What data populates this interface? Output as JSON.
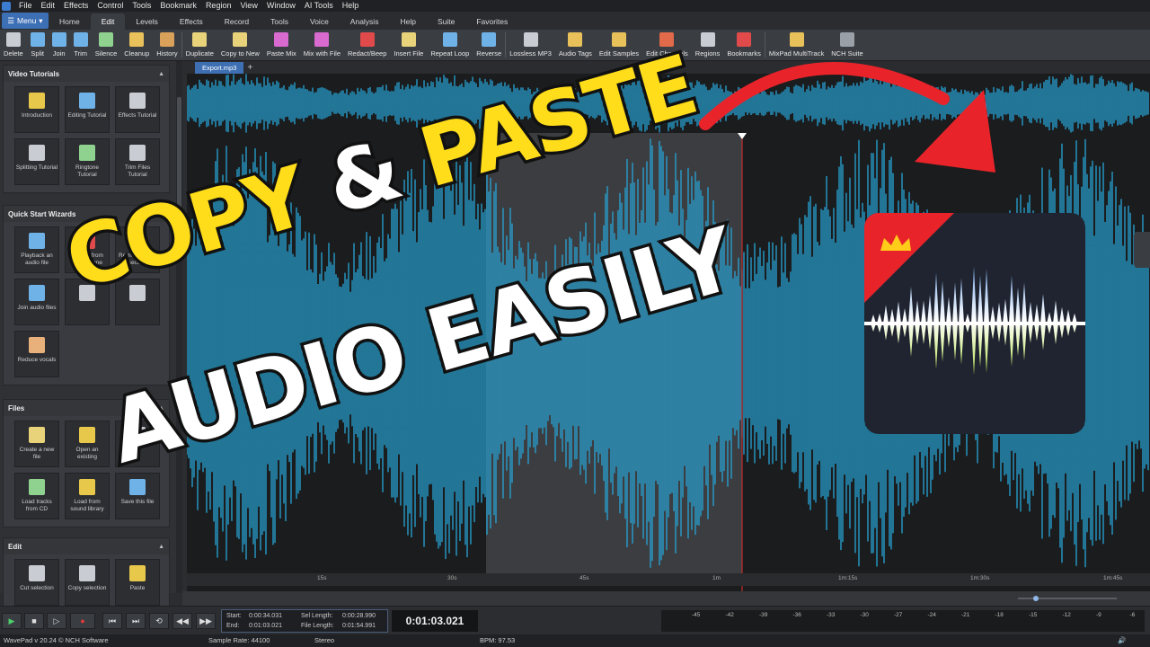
{
  "menubar": [
    "File",
    "Edit",
    "Effects",
    "Control",
    "Tools",
    "Bookmark",
    "Region",
    "View",
    "Window",
    "AI Tools",
    "Help"
  ],
  "ribbon": {
    "menu_label": "Menu",
    "tabs": [
      "Home",
      "Edit",
      "Levels",
      "Effects",
      "Record",
      "Tools",
      "Voice",
      "Analysis",
      "Help",
      "Suite",
      "Favorites"
    ],
    "active_tab": "Edit"
  },
  "toolbar": [
    {
      "label": "Delete",
      "icon": "trash-icon",
      "color": "#c9ccd2"
    },
    {
      "label": "Split",
      "icon": "split-icon",
      "color": "#6fb2e8"
    },
    {
      "label": "Join",
      "icon": "join-icon",
      "color": "#6fb2e8"
    },
    {
      "label": "Trim",
      "icon": "trim-icon",
      "color": "#6fb2e8"
    },
    {
      "label": "Silence",
      "icon": "silence-icon",
      "color": "#8fd18f"
    },
    {
      "label": "Cleanup",
      "icon": "broom-icon",
      "color": "#e8c15a"
    },
    {
      "label": "History",
      "icon": "history-icon",
      "color": "#d9a15a"
    },
    {
      "label": "Duplicate",
      "icon": "duplicate-icon",
      "color": "#e8d27a"
    },
    {
      "label": "Copy to New",
      "icon": "copy-new-icon",
      "color": "#e8d27a"
    },
    {
      "label": "Paste Mix",
      "icon": "paste-mix-icon",
      "color": "#d86ad0"
    },
    {
      "label": "Mix with File",
      "icon": "mix-file-icon",
      "color": "#d86ad0"
    },
    {
      "label": "Redact/Beep",
      "icon": "beep-icon",
      "color": "#e04a4a"
    },
    {
      "label": "Insert File",
      "icon": "insert-file-icon",
      "color": "#e8d27a"
    },
    {
      "label": "Repeat Loop",
      "icon": "loop-icon",
      "color": "#6fb2e8"
    },
    {
      "label": "Reverse",
      "icon": "reverse-icon",
      "color": "#6fb2e8"
    },
    {
      "label": "Lossless MP3",
      "icon": "mp3-icon",
      "color": "#c9ccd2"
    },
    {
      "label": "Audio Tags",
      "icon": "tag-icon",
      "color": "#e8c15a"
    },
    {
      "label": "Edit Samples",
      "icon": "pencil-icon",
      "color": "#e8c15a"
    },
    {
      "label": "Edit Channels",
      "icon": "channels-icon",
      "color": "#e06a4a"
    },
    {
      "label": "Regions",
      "icon": "regions-icon",
      "color": "#c9ccd2"
    },
    {
      "label": "Bookmarks",
      "icon": "bookmark-icon",
      "color": "#e04a4a"
    },
    {
      "label": "MixPad MultiTrack",
      "icon": "mixpad-icon",
      "color": "#e8c15a"
    },
    {
      "label": "NCH Suite",
      "icon": "nch-suite-icon",
      "color": "#9aa0a8"
    }
  ],
  "sidebar": {
    "panels": [
      {
        "title": "Video Tutorials",
        "tiles": [
          {
            "label": "Introduction",
            "icon": "lightbulb-icon",
            "color": "#e8c84a"
          },
          {
            "label": "Editing Tutorial",
            "icon": "editing-icon",
            "color": "#6fb2e8"
          },
          {
            "label": "Effects Tutorial",
            "icon": "effects-icon",
            "color": "#c9ccd2"
          },
          {
            "label": "Splitting Tutorial",
            "icon": "scissors-icon",
            "color": "#c9ccd2"
          },
          {
            "label": "Ringtone Tutorial",
            "icon": "phone-icon",
            "color": "#8fd18f"
          },
          {
            "label": "Trim Files Tutorial",
            "icon": "trim-icon",
            "color": "#c9ccd2"
          }
        ]
      },
      {
        "title": "Quick Start Wizards",
        "tiles": [
          {
            "label": "Playback an audio file",
            "icon": "playback-icon",
            "color": "#6fb2e8"
          },
          {
            "label": "Record from microphone",
            "icon": "microphone-icon",
            "color": "#e04a4a"
          },
          {
            "label": "Remove audio section",
            "icon": "remove-section-icon",
            "color": "#8fd18f"
          },
          {
            "label": "Join audio files",
            "icon": "join-icon",
            "color": "#6fb2e8"
          },
          {
            "label": "",
            "icon": "wizard-icon",
            "color": "#c9ccd2"
          },
          {
            "label": "",
            "icon": "wizard-icon",
            "color": "#c9ccd2"
          },
          {
            "label": "Reduce vocals",
            "icon": "vocals-icon",
            "color": "#e8b07a"
          }
        ]
      },
      {
        "title": "Files",
        "tiles": [
          {
            "label": "Create a new file",
            "icon": "new-file-icon",
            "color": "#e8d27a"
          },
          {
            "label": "Open an existing",
            "icon": "open-folder-icon",
            "color": "#e8c84a"
          },
          {
            "label": "",
            "icon": "file-icon",
            "color": "#c9ccd2"
          },
          {
            "label": "Load tracks from CD",
            "icon": "cd-icon",
            "color": "#8fd18f"
          },
          {
            "label": "Load from sound library",
            "icon": "library-icon",
            "color": "#e8c84a"
          },
          {
            "label": "Save this file",
            "icon": "save-icon",
            "color": "#6fb2e8"
          }
        ]
      },
      {
        "title": "Edit",
        "tiles": [
          {
            "label": "Cut selection",
            "icon": "scissors-icon",
            "color": "#c9ccd2"
          },
          {
            "label": "Copy selection",
            "icon": "copy-icon",
            "color": "#c9ccd2"
          },
          {
            "label": "Paste",
            "icon": "paste-icon",
            "color": "#e8c84a"
          }
        ]
      }
    ]
  },
  "document_tab": "Export.mp3",
  "ruler_labels": [
    "15s",
    "30s",
    "45s",
    "1m",
    "1m:15s",
    "1m:30s",
    "1m:45s"
  ],
  "selection": {
    "start_label": "Start:",
    "start": "0:00:34.031",
    "end_label": "End:",
    "end": "0:01:03.021",
    "sel_length_label": "Sel Length:",
    "sel_length": "0:00:28.990",
    "file_length_label": "File Length:",
    "file_length": "0:01:54.991"
  },
  "current_time": "0:01:03.021",
  "meter_labels": [
    "-45",
    "-42",
    "-39",
    "-36",
    "-33",
    "-30",
    "-27",
    "-24",
    "-21",
    "-18",
    "-15",
    "-12",
    "-9",
    "-6"
  ],
  "status": {
    "app": "WavePad v 20.24 © NCH Software",
    "sample_rate": "Sample Rate: 44100",
    "channels": "Stereo",
    "bpm": "BPM: 97.53"
  },
  "overlay": {
    "word_copy": "COPY",
    "word_amp": "&",
    "word_paste": "PASTE",
    "line2": "AUDIO EASILY"
  },
  "colors": {
    "wave": "#27a6d6",
    "wave_selected": "#33b8e6",
    "headline_yellow": "#ffdd1a",
    "arrow": "#e8242a",
    "playhead": "#e03030"
  }
}
